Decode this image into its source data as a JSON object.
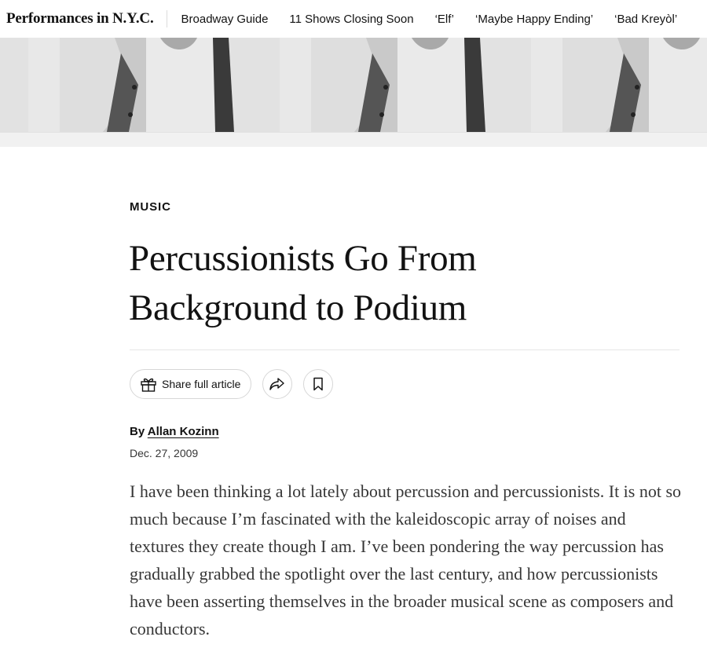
{
  "nav": {
    "brand": "Performances in N.Y.C.",
    "links": [
      "Broadway Guide",
      "11 Shows Closing Soon",
      "‘Elf’",
      "‘Maybe Happy Ending’",
      "‘Bad Kreyòl’"
    ]
  },
  "hero": {
    "image": "black-and-white photo of a sweater, repeated"
  },
  "article": {
    "kicker": "MUSIC",
    "headline": "Percussionists Go From Background to Podium",
    "share_label": "Share full article",
    "share_icon": "gift-icon",
    "forward_icon": "share-arrow-icon",
    "save_icon": "bookmark-icon",
    "byline_prefix": "By ",
    "author": "Allan Kozinn",
    "date": "Dec. 27, 2009",
    "body": "I have been thinking a lot lately about percussion and percussionists. It is not so much because I’m fascinated with the kaleidoscopic array of noises and textures they create    though I am. I’ve been pondering the way percussion has gradually grabbed the spotlight over the last century, and how percussionists have been asserting themselves in the broader musical scene as composers and conductors."
  },
  "colors": {
    "text": "#121212",
    "body_text": "#363636",
    "divider": "#e6e6e6"
  }
}
